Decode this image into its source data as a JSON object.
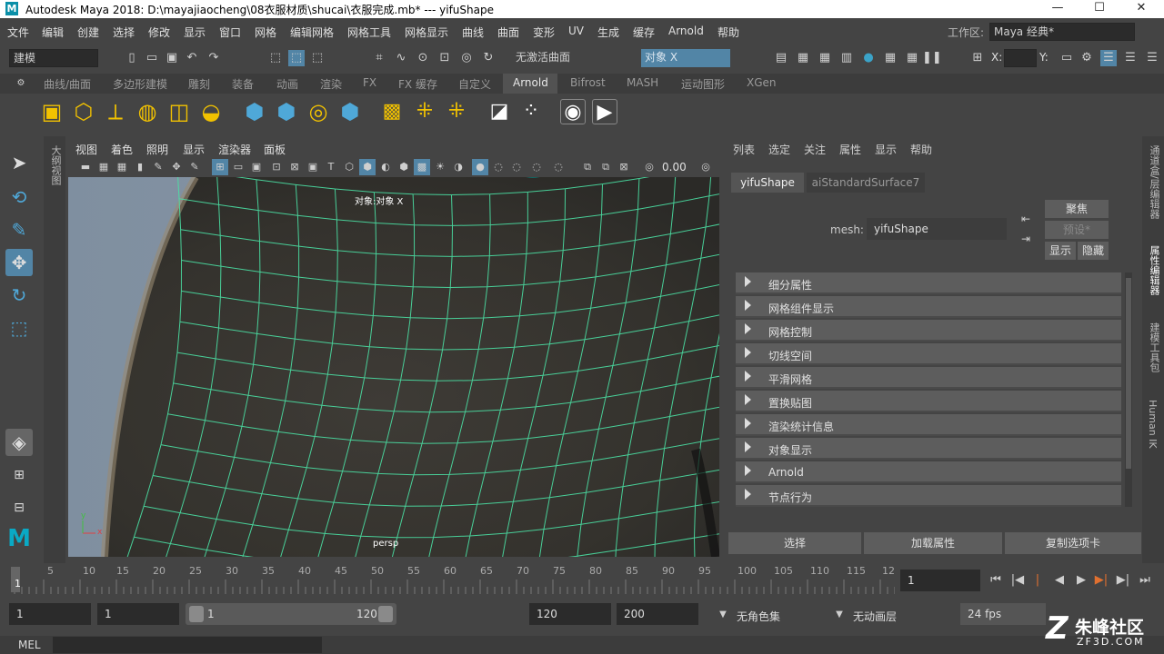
{
  "window": {
    "title": "Autodesk Maya 2018: D:\\mayajiaocheng\\08衣服材质\\shucai\\衣服完成.mb*   ---   yifuShape",
    "logo": "M",
    "min": "—",
    "max": "☐",
    "close": "✕"
  },
  "menubar": {
    "items": [
      "文件",
      "编辑",
      "创建",
      "选择",
      "修改",
      "显示",
      "窗口",
      "网格",
      "编辑网格",
      "网格工具",
      "网格显示",
      "曲线",
      "曲面",
      "变形",
      "UV",
      "生成",
      "缓存",
      "Arnold",
      "帮助"
    ],
    "workspace_label": "工作区:",
    "workspace_value": "Maya 经典*"
  },
  "statusline": {
    "mode": "建模",
    "live_surface": "无激活曲面",
    "object_field": "对象 X",
    "x_label": "X:",
    "y_label": "Y:"
  },
  "shelf_tabs": [
    "曲线/曲面",
    "多边形建模",
    "雕刻",
    "装备",
    "动画",
    "渲染",
    "FX",
    "FX 缓存",
    "自定义",
    "Arnold",
    "Bifrost",
    "MASH",
    "运动图形",
    "XGen"
  ],
  "shelf_active": "Arnold",
  "outliner_label": "大纲视图",
  "viewport": {
    "menus": [
      "视图",
      "着色",
      "照明",
      "显示",
      "渲染器",
      "面板"
    ],
    "exposure": "0.00",
    "hud_top": "对象:对象 X",
    "camera": "persp",
    "axis_x": "x",
    "axis_y": "y"
  },
  "attribute_editor": {
    "menus": [
      "列表",
      "选定",
      "关注",
      "属性",
      "显示",
      "帮助"
    ],
    "tabs": [
      "yifuShape",
      "aiStandardSurface7"
    ],
    "mesh_label": "mesh:",
    "mesh_value": "yifuShape",
    "focus": "聚焦",
    "preset": "预设*",
    "show": "显示",
    "hide": "隐藏",
    "sections": [
      "细分属性",
      "网格组件显示",
      "网格控制",
      "切线空间",
      "平滑网格",
      "置换贴图",
      "渲染统计信息",
      "对象显示",
      "Arnold",
      "节点行为"
    ],
    "bottom_buttons": [
      "选择",
      "加载属性",
      "复制选项卡"
    ]
  },
  "right_strip": [
    "通道盒/层编辑器",
    "属性编辑器",
    "建模工具包",
    "Human IK"
  ],
  "timeslider": {
    "ticks": [
      "1",
      "5",
      "10",
      "15",
      "20",
      "25",
      "30",
      "35",
      "40",
      "45",
      "50",
      "55",
      "60",
      "65",
      "70",
      "75",
      "80",
      "85",
      "90",
      "95",
      "100",
      "105",
      "110",
      "115",
      "12"
    ],
    "current_frame": "1"
  },
  "rangeslider": {
    "start": "1",
    "start2": "1",
    "range_start": "1",
    "range_end": "120",
    "end": "120",
    "max": "200",
    "char_set": "无角色集",
    "anim_layer": "无动画层",
    "fps": "24 fps"
  },
  "cmdline": {
    "label": "MEL"
  },
  "watermark": {
    "text": "朱峰社区",
    "url": "ZF3D.COM"
  }
}
